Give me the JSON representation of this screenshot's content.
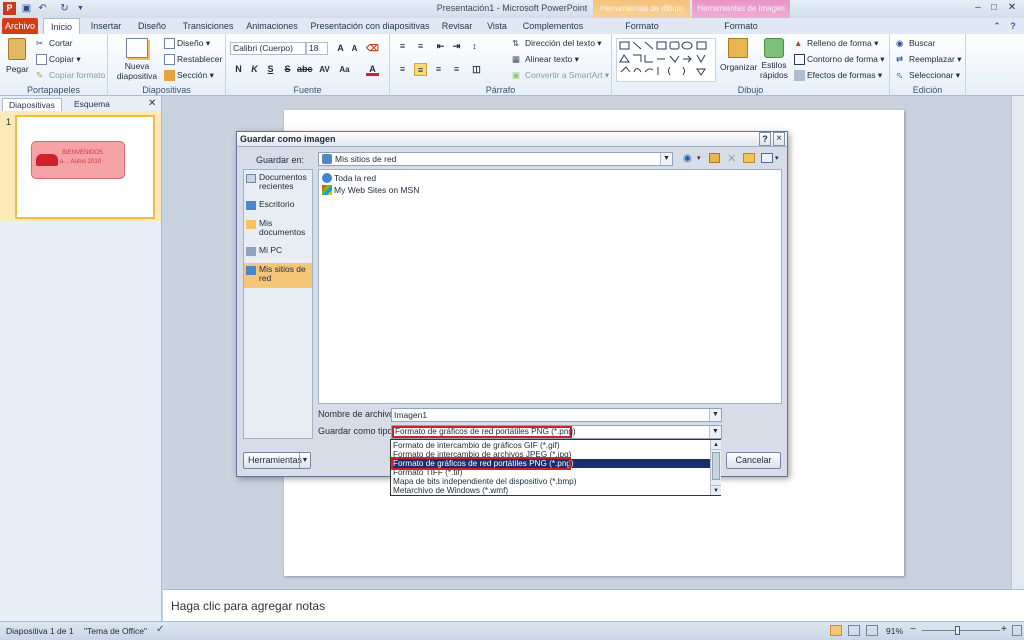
{
  "window": {
    "title": "Presentación1 - Microsoft PowerPoint"
  },
  "context_groups": [
    {
      "name": "Herramientas de dibujo",
      "tab": "Formato",
      "color": "#f6c27a"
    },
    {
      "name": "Herramientas de imagen",
      "tab": "Formato",
      "color": "#e893c7"
    }
  ],
  "tabs": [
    "Archivo",
    "Inicio",
    "Insertar",
    "Diseño",
    "Transiciones",
    "Animaciones",
    "Presentación con diapositivas",
    "Revisar",
    "Vista",
    "Complementos"
  ],
  "ribbon": {
    "portapapeles": {
      "label": "Portapapeles",
      "pegar": "Pegar",
      "cortar": "Cortar",
      "copiar": "Copiar",
      "copiar_formato": "Copiar formato"
    },
    "diapositivas": {
      "label": "Diapositivas",
      "nueva": "Nueva diapositiva",
      "diseno": "Diseño",
      "restablecer": "Restablecer",
      "seccion": "Sección"
    },
    "fuente": {
      "label": "Fuente",
      "font": "Calibri (Cuerpo)",
      "size": "18"
    },
    "parrafo": {
      "label": "Párrafo",
      "direccion": "Dirección del texto",
      "alinear": "Alinear texto",
      "smartart": "Convertir a SmartArt"
    },
    "dibujo": {
      "label": "Dibujo",
      "organizar": "Organizar",
      "estilos": "Estilos rápidos",
      "relleno": "Relleno de forma",
      "contorno": "Contorno de forma",
      "efectos": "Efectos de formas"
    },
    "edicion": {
      "label": "Edición",
      "buscar": "Buscar",
      "reemplazar": "Reemplazar",
      "seleccionar": "Seleccionar"
    }
  },
  "left_pane": {
    "tabs": [
      "Diapositivas",
      "Esquema"
    ],
    "slide_number": "1",
    "thumb_text_1": "BIENVENIDOS",
    "thumb_text_2": "a… Autos 2010"
  },
  "dialog": {
    "title": "Guardar como imagen",
    "guardar_en_label": "Guardar en:",
    "guardar_en_value": "Mis sitios de red",
    "places": [
      {
        "label": "Documentos recientes",
        "selected": false
      },
      {
        "label": "Escritorio",
        "selected": false
      },
      {
        "label": "Mis documentos",
        "selected": false
      },
      {
        "label": "Mi PC",
        "selected": false
      },
      {
        "label": "Mis sitios de red",
        "selected": true
      }
    ],
    "files": [
      "Toda la red",
      "My Web Sites on MSN"
    ],
    "nombre_label": "Nombre de archivo:",
    "nombre_value": "Imagen1",
    "tipo_label": "Guardar como tipo:",
    "tipo_value": "Formato de gráficos de red portátiles PNG (*.png)",
    "type_options": [
      "Formato de intercambio de gráficos GIF (*.gif)",
      "Formato de intercambio de archivos JPEG (*.jpg)",
      "Formato de gráficos de red portátiles PNG (*.png)",
      "Formato TIFF (*.tif)",
      "Mapa de bits independiente del dispositivo (*.bmp)",
      "Metarchivo de Windows (*.wmf)"
    ],
    "selected_type_index": 2,
    "herramientas": "Herramientas",
    "cancelar": "Cancelar",
    "help": "?",
    "close": "×"
  },
  "notes": {
    "placeholder": "Haga clic para agregar notas"
  },
  "status": {
    "slide": "Diapositiva 1 de 1",
    "theme": "\"Tema de Office\"",
    "zoom": "91%"
  }
}
